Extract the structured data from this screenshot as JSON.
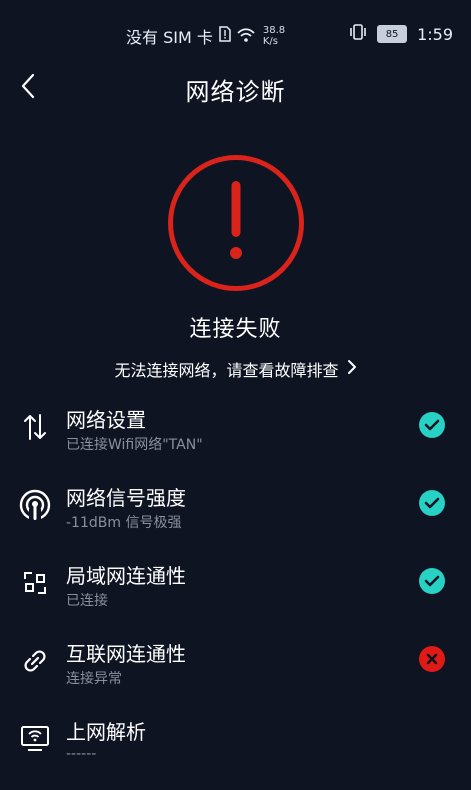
{
  "status_bar": {
    "carrier": "没有 SIM 卡",
    "speed_value": "38.8",
    "speed_unit": "K/s",
    "battery": "85",
    "time": "1:59"
  },
  "header": {
    "title": "网络诊断"
  },
  "result": {
    "title": "连接失败",
    "link_text": "无法连接网络，请查看故障排查"
  },
  "checks": [
    {
      "title": "网络设置",
      "subtitle": "已连接Wifi网络\"TAN\"",
      "status": "ok"
    },
    {
      "title": "网络信号强度",
      "subtitle": "-11dBm 信号极强",
      "status": "ok"
    },
    {
      "title": "局域网连通性",
      "subtitle": "已连接",
      "status": "ok"
    },
    {
      "title": "互联网连通性",
      "subtitle": "连接异常",
      "status": "fail"
    },
    {
      "title": "上网解析",
      "subtitle": "------",
      "status": "pending"
    }
  ],
  "colors": {
    "background": "#0f1423",
    "error_red": "#d9231b",
    "ok_teal": "#27d1c3",
    "fail_red": "#e01a16",
    "subtitle_gray": "#8a8f9d"
  },
  "icons": {
    "back": "back-arrow-icon",
    "error": "exclamation-icon",
    "link_chevron": "chevron-right-icon",
    "row_icons": [
      "transfer-arrows-icon",
      "signal-broadcast-icon",
      "lan-icon",
      "link-icon",
      "monitor-wifi-icon"
    ],
    "ok": "check-icon",
    "fail": "cross-icon"
  }
}
